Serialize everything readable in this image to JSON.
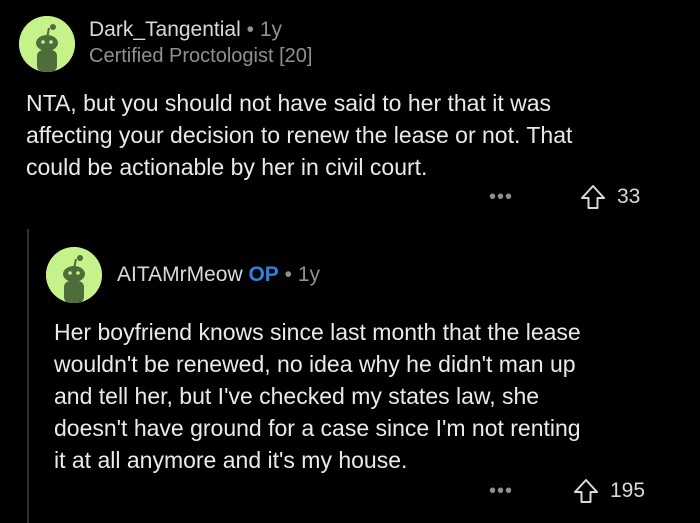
{
  "colors": {
    "background": "#000000",
    "avatar_green": "#c5f28a",
    "op_blue": "#2e7fe6",
    "muted": "#8d9195",
    "text": "#e8eaed"
  },
  "comments": [
    {
      "username": "Dark_Tangential",
      "separator": "•",
      "age": "1y",
      "flair": "Certified Proctologist [20]",
      "body": "NTA, but you should not have said to her that it was\naffecting your decision to renew the lease or not. That\ncould be actionable by her in civil court.",
      "more": "•••",
      "upvotes": "33",
      "icons": {
        "avatar": "snoo-avatar-icon",
        "upvote": "upvote-arrow-icon",
        "more": "more-options-icon"
      }
    },
    {
      "username": "AITAMrMeow",
      "badge": "OP",
      "separator": "•",
      "age": "1y",
      "body": "Her boyfriend knows since last month that the lease\nwouldn't be renewed, no idea why he didn't man up\nand tell her, but I've checked my states law, she\ndoesn't have ground for a case since I'm not renting\nit at all anymore and it's my house.",
      "more": "•••",
      "upvotes": "195",
      "icons": {
        "avatar": "snoo-avatar-icon",
        "upvote": "upvote-arrow-icon",
        "more": "more-options-icon"
      }
    }
  ]
}
